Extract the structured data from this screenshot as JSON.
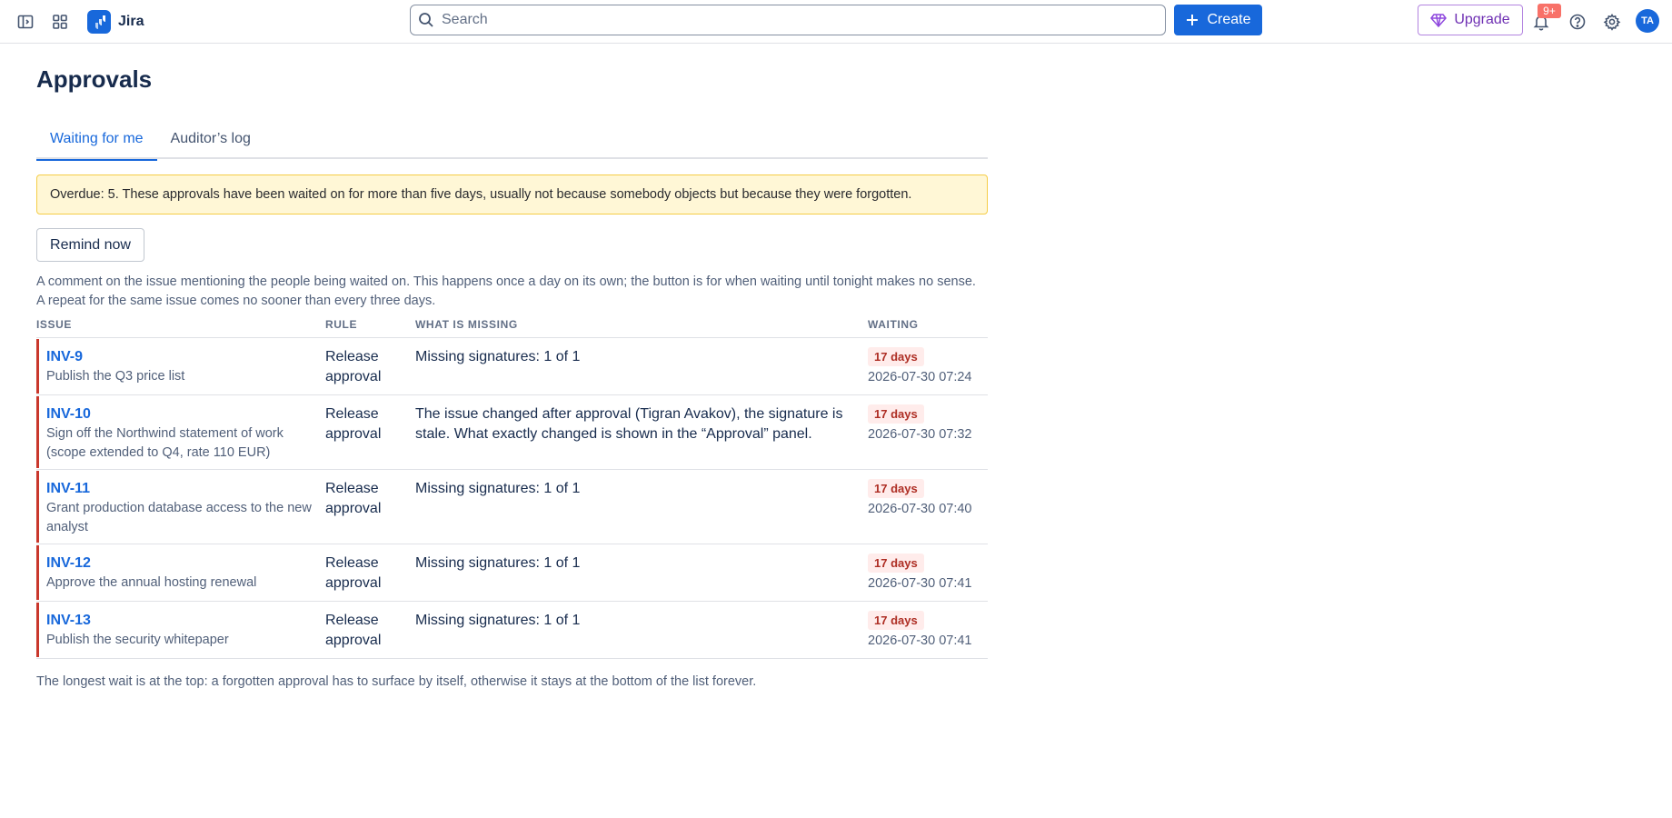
{
  "app": {
    "name": "Jira",
    "search_placeholder": "Search",
    "create_label": "Create",
    "upgrade_label": "Upgrade",
    "notification_count": "9+",
    "avatar_initials": "TA",
    "colors": {
      "brand": "#1868db",
      "upgrade": "#6e2fb3",
      "danger": "#c9372c",
      "warning_bg": "#fff7d6"
    }
  },
  "page": {
    "title": "Approvals",
    "tabs": [
      {
        "label": "Waiting for me",
        "active": true
      },
      {
        "label": "Auditor’s log",
        "active": false
      }
    ],
    "warning": "Overdue: 5. These approvals have been waited on for more than five days, usually not because somebody objects but because they were forgotten.",
    "remind_button": "Remind now",
    "help_line1": "A comment on the issue mentioning the people being waited on. This happens once a day on its own; the button is for when waiting until tonight makes no sense.",
    "help_line2": "A repeat for the same issue comes no sooner than every three days.",
    "footnote": "The longest wait is at the top: a forgotten approval has to surface by itself, otherwise it stays at the bottom of the list forever."
  },
  "table": {
    "columns": [
      "ISSUE",
      "RULE",
      "WHAT IS MISSING",
      "WAITING"
    ],
    "rows": [
      {
        "key": "INV-9",
        "summary": "Publish the Q3 price list",
        "rule": "Release approval",
        "missing": "Missing signatures: 1 of 1",
        "age": "17 days",
        "since": "2026-07-30 07:24"
      },
      {
        "key": "INV-10",
        "summary": "Sign off the Northwind statement of work (scope extended to Q4, rate 110 EUR)",
        "rule": "Release approval",
        "missing": "The issue changed after approval (Tigran Avakov), the signature is stale. What exactly changed is shown in the “Approval” panel.",
        "age": "17 days",
        "since": "2026-07-30 07:32"
      },
      {
        "key": "INV-11",
        "summary": "Grant production database access to the new analyst",
        "rule": "Release approval",
        "missing": "Missing signatures: 1 of 1",
        "age": "17 days",
        "since": "2026-07-30 07:40"
      },
      {
        "key": "INV-12",
        "summary": "Approve the annual hosting renewal",
        "rule": "Release approval",
        "missing": "Missing signatures: 1 of 1",
        "age": "17 days",
        "since": "2026-07-30 07:41"
      },
      {
        "key": "INV-13",
        "summary": "Publish the security whitepaper",
        "rule": "Release approval",
        "missing": "Missing signatures: 1 of 1",
        "age": "17 days",
        "since": "2026-07-30 07:41"
      }
    ]
  }
}
